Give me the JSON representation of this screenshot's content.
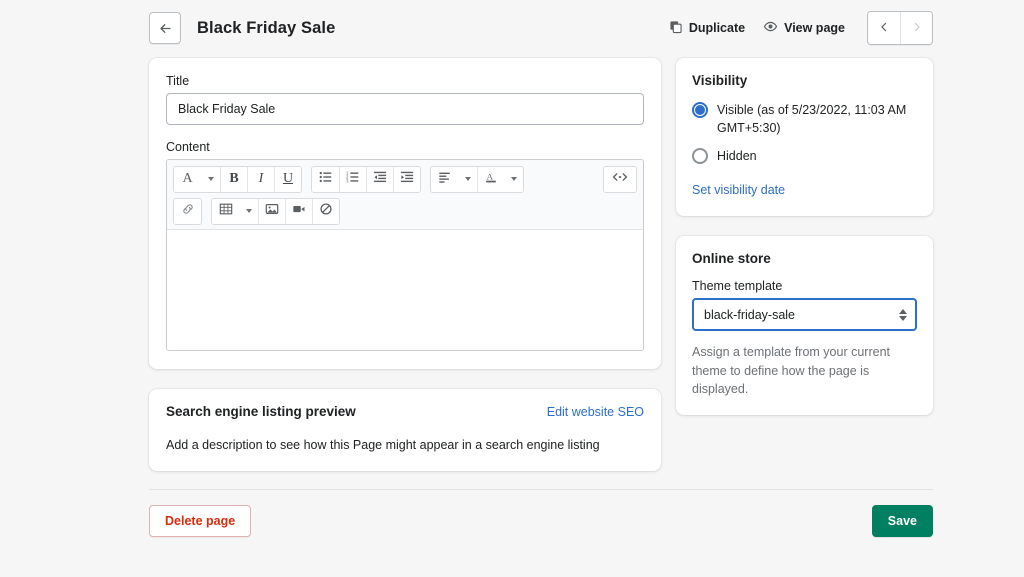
{
  "header": {
    "back_icon": "arrow-left-icon",
    "title": "Black Friday Sale",
    "duplicate_label": "Duplicate",
    "duplicate_icon": "duplicate-icon",
    "view_page_label": "View page",
    "view_page_icon": "eye-icon",
    "prev_icon": "chevron-left-icon",
    "next_icon": "chevron-right-icon"
  },
  "main": {
    "title_label": "Title",
    "title_value": "Black Friday Sale",
    "content_label": "Content",
    "editor": {
      "row1": [
        {
          "name": "font-style-button",
          "glyph": "A",
          "caret": true
        },
        {
          "name": "bold-button",
          "glyph": "B",
          "caret": false
        },
        {
          "name": "italic-button",
          "glyph": "I",
          "caret": false
        },
        {
          "name": "underline-button",
          "glyph": "U",
          "caret": false
        },
        {
          "name": "bulleted-list-button",
          "glyph": "bullet-list-icon",
          "caret": false
        },
        {
          "name": "numbered-list-button",
          "glyph": "numbered-list-icon",
          "caret": false
        },
        {
          "name": "outdent-button",
          "glyph": "outdent-icon",
          "caret": false
        },
        {
          "name": "indent-button",
          "glyph": "indent-icon",
          "caret": false
        },
        {
          "name": "align-button",
          "glyph": "align-left-icon",
          "caret": true
        },
        {
          "name": "text-color-button",
          "glyph": "text-color-icon",
          "caret": true
        },
        {
          "name": "html-code-button",
          "glyph": "<>",
          "caret": false
        }
      ],
      "row2": [
        {
          "name": "insert-link-button",
          "glyph": "link-icon",
          "caret": false
        },
        {
          "name": "insert-table-button",
          "glyph": "table-icon",
          "caret": true
        },
        {
          "name": "insert-image-button",
          "glyph": "image-icon",
          "caret": false
        },
        {
          "name": "insert-video-button",
          "glyph": "video-icon",
          "caret": false
        },
        {
          "name": "clear-formatting-button",
          "glyph": "no-formatting-icon",
          "caret": false
        }
      ],
      "body_value": ""
    }
  },
  "seo": {
    "title": "Search engine listing preview",
    "edit_link": "Edit website SEO",
    "description": "Add a description to see how this Page might appear in a search engine listing"
  },
  "visibility": {
    "title": "Visibility",
    "options": [
      {
        "label": "Visible (as of 5/23/2022, 11:03 AM GMT+5:30)",
        "selected": true
      },
      {
        "label": "Hidden",
        "selected": false
      }
    ],
    "set_date_link": "Set visibility date"
  },
  "online_store": {
    "title": "Online store",
    "template_label": "Theme template",
    "template_value": "black-friday-sale",
    "help_text": "Assign a template from your current theme to define how the page is displayed."
  },
  "footer": {
    "delete_label": "Delete page",
    "save_label": "Save"
  },
  "colors": {
    "page_bg": "#f6f6f7",
    "accent_blue": "#2c6ecb",
    "save_green": "#008060",
    "delete_red": "#d72c0d"
  }
}
